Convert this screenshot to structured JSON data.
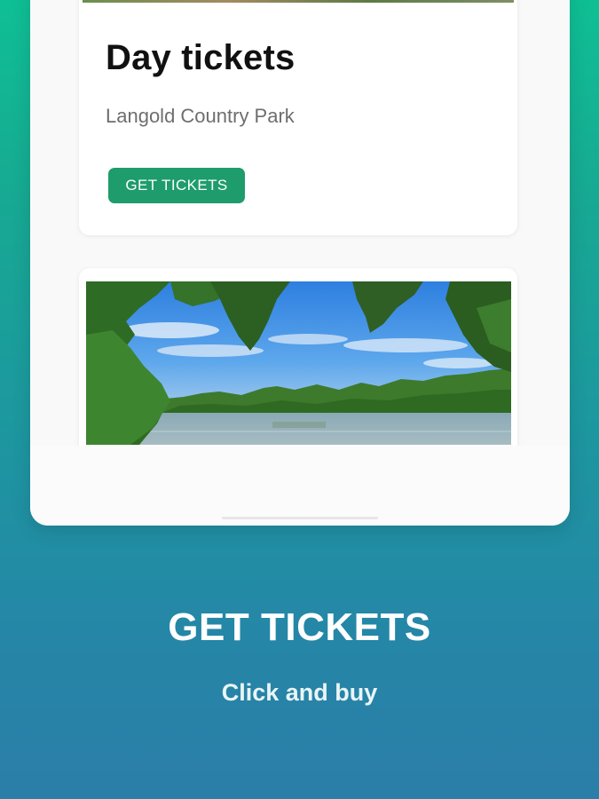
{
  "card": {
    "title": "Day tickets",
    "subtitle": "Langold Country Park",
    "button_label": "GET TICKETS",
    "button_color": "#1e9c6c"
  },
  "promo": {
    "title": "GET TICKETS",
    "subtitle": "Click and buy"
  },
  "colors": {
    "gradient_top": "#0fbf94",
    "gradient_bottom": "#2b7ea8"
  }
}
